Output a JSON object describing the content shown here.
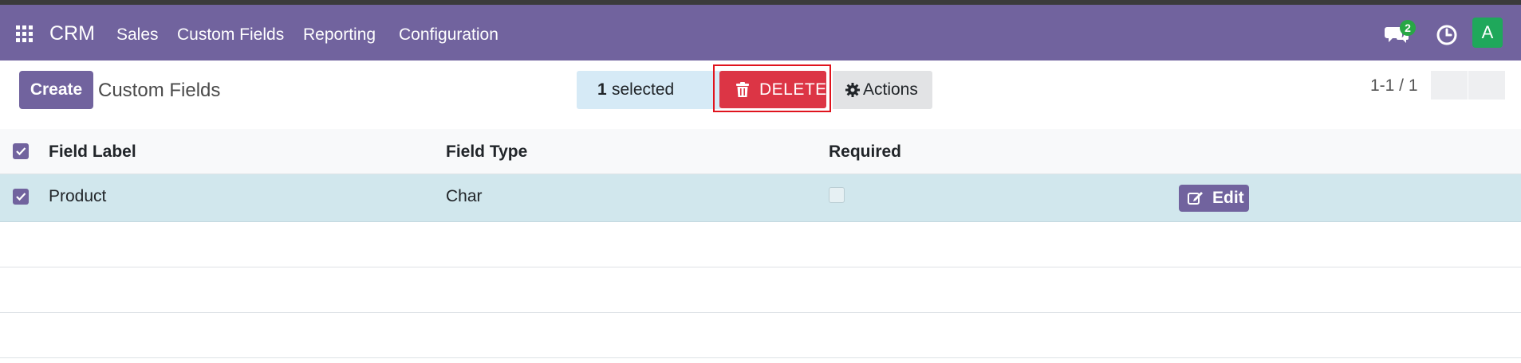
{
  "app": {
    "name": "CRM"
  },
  "menu": {
    "sales": "Sales",
    "custom_fields": "Custom Fields",
    "reporting": "Reporting",
    "configuration": "Configuration"
  },
  "systray": {
    "messages_count": "2",
    "avatar_initial": "A"
  },
  "control_panel": {
    "create_label": "Create",
    "title": "Custom Fields",
    "selected_count": "1",
    "selected_text": "selected",
    "delete_label": "DELETE",
    "actions_label": "Actions",
    "pager": "1-1 / 1"
  },
  "table": {
    "headers": {
      "field_label": "Field Label",
      "field_type": "Field Type",
      "required": "Required"
    },
    "rows": [
      {
        "field_label": "Product",
        "field_type": "Char",
        "required": false,
        "selected": true,
        "edit_label": "Edit"
      }
    ]
  },
  "colors": {
    "brand": "#71639e",
    "danger": "#dc3545",
    "selected_row": "#d1e7ed"
  }
}
